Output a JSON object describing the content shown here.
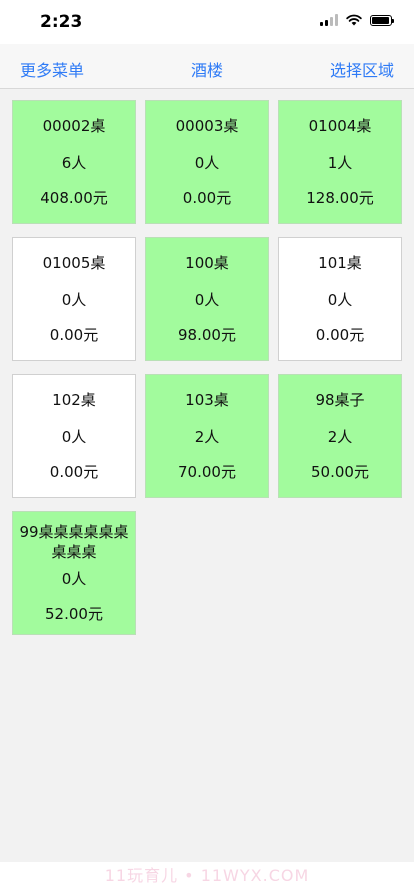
{
  "status": {
    "time": "2:23"
  },
  "nav": {
    "left": "更多菜单",
    "title": "酒楼",
    "right": "选择区域"
  },
  "tables": [
    {
      "name": "00002桌",
      "people": "6人",
      "amount": "408.00元",
      "occupied": true
    },
    {
      "name": "00003桌",
      "people": "0人",
      "amount": "0.00元",
      "occupied": true
    },
    {
      "name": "01004桌",
      "people": "1人",
      "amount": "128.00元",
      "occupied": true
    },
    {
      "name": "01005桌",
      "people": "0人",
      "amount": "0.00元",
      "occupied": false
    },
    {
      "name": "100桌",
      "people": "0人",
      "amount": "98.00元",
      "occupied": true
    },
    {
      "name": "101桌",
      "people": "0人",
      "amount": "0.00元",
      "occupied": false
    },
    {
      "name": "102桌",
      "people": "0人",
      "amount": "0.00元",
      "occupied": false
    },
    {
      "name": "103桌",
      "people": "2人",
      "amount": "70.00元",
      "occupied": true
    },
    {
      "name": "98桌子",
      "people": "2人",
      "amount": "50.00元",
      "occupied": true
    },
    {
      "name": "99桌桌桌桌桌桌桌桌桌",
      "people": "0人",
      "amount": "52.00元",
      "occupied": true
    }
  ],
  "watermark": "11玩育儿 • 11WYX.COM"
}
